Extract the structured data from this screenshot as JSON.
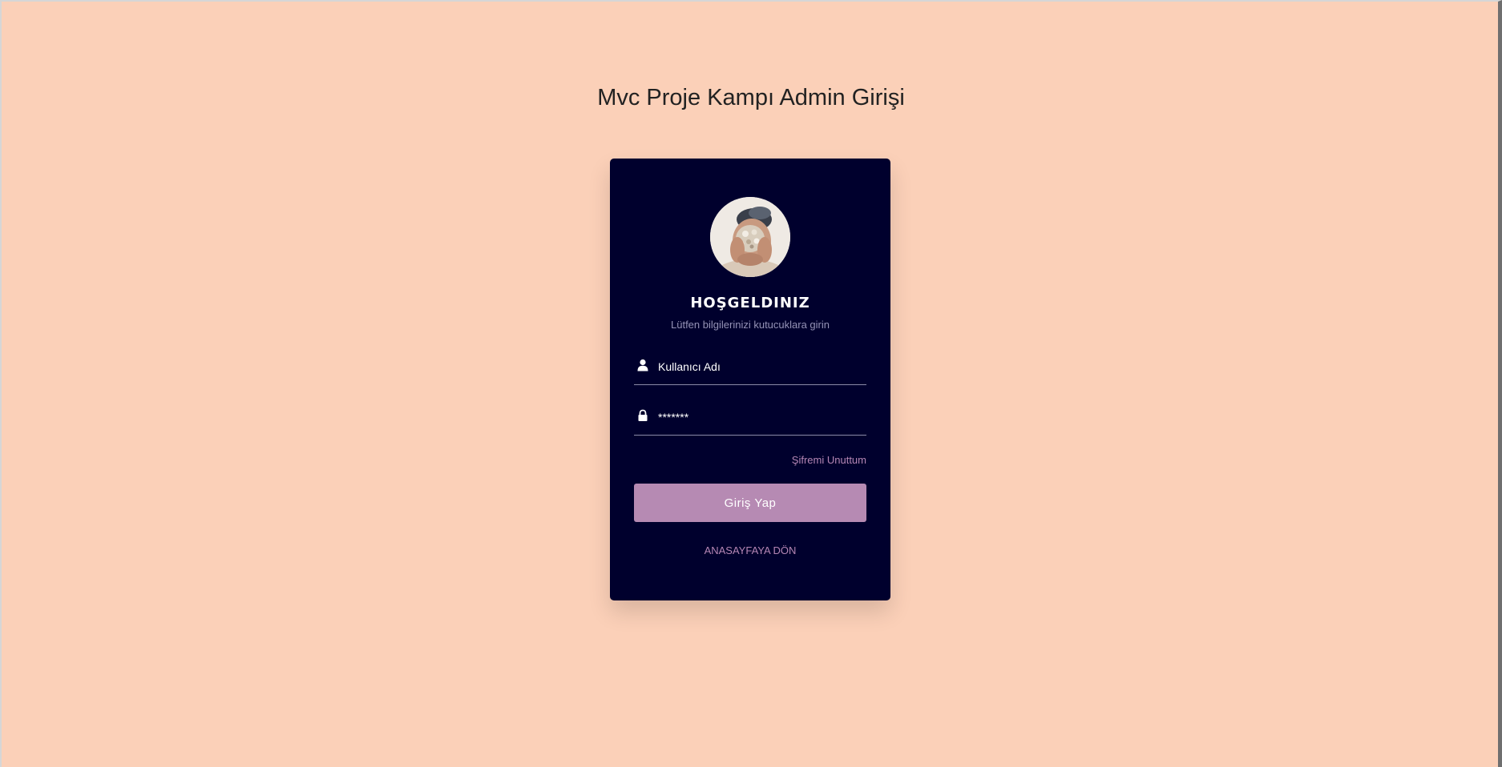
{
  "page": {
    "title": "Mvc Proje Kampı Admin Girişi",
    "background_color": "#fbd0b8"
  },
  "card": {
    "background_color": "#00002d",
    "welcome_title": "HOŞGELDINIZ",
    "welcome_subtitle": "Lütfen bilgilerinizi kutucuklara girin",
    "username": {
      "icon": "user-icon",
      "placeholder": "Kullanıcı Adı",
      "value": ""
    },
    "password": {
      "icon": "lock-icon",
      "placeholder": "*******",
      "value": ""
    },
    "forgot_password_label": "Şifremi Unuttum",
    "login_button_label": "Giriş Yap",
    "login_button_color": "#b68ab3",
    "home_link_label": "ANASAYFAYA DÖN",
    "link_color": "#b586b4"
  }
}
